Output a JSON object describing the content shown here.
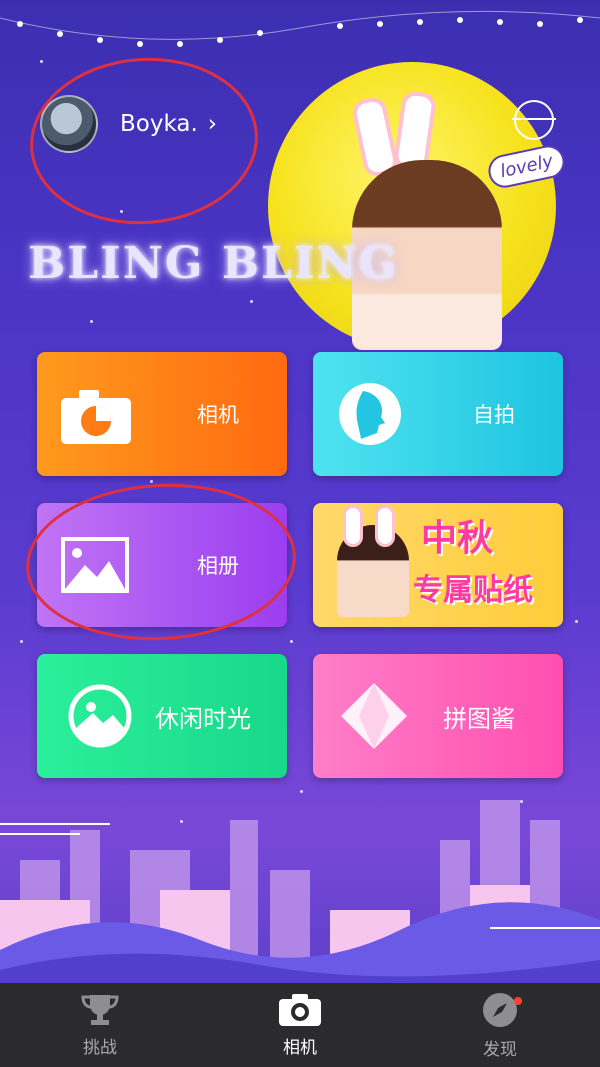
{
  "profile": {
    "username": "Boyka.",
    "chevron": "›"
  },
  "decor": {
    "bling_text": "BLING BLING",
    "lovely_text": "lovely"
  },
  "tiles": {
    "camera": {
      "label": "相机",
      "icon": "camera-icon"
    },
    "selfie": {
      "label": "自拍",
      "icon": "face-profile-icon"
    },
    "album": {
      "label": "相册",
      "icon": "image-icon"
    },
    "banner": {
      "line1": "中秋",
      "line2": "专属贴纸"
    },
    "leisure": {
      "label": "休闲时光",
      "icon": "landscape-circle-icon"
    },
    "puzzle": {
      "label": "拼图酱",
      "icon": "diamond-icon"
    }
  },
  "nav": {
    "challenge": "挑战",
    "camera": "相机",
    "discover": "发现"
  },
  "colors": {
    "annotation_red": "#e0303e",
    "nav_bg": "#2b2b2e"
  }
}
